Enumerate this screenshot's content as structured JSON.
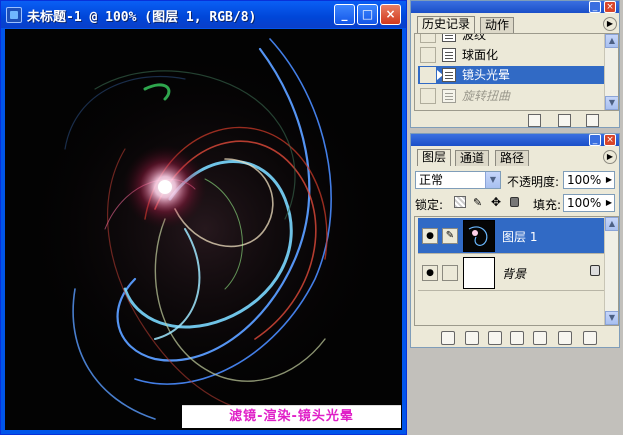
{
  "document": {
    "title": "未标题-1 @ 100% (图层 1, RGB/8)",
    "caption": "滤镜-渲染-镜头光晕",
    "controls": {
      "minimize": "_",
      "maximize": "□",
      "close": "×"
    }
  },
  "history_panel": {
    "tabs": [
      {
        "label": "历史记录",
        "active": true
      },
      {
        "label": "动作",
        "active": false
      }
    ],
    "menu_arrow": "▶",
    "items": [
      {
        "label": "波纹",
        "state": "normal"
      },
      {
        "label": "球面化",
        "state": "normal"
      },
      {
        "label": "镜头光晕",
        "state": "selected"
      },
      {
        "label": "旋转扭曲",
        "state": "faded"
      }
    ]
  },
  "layers_panel": {
    "tabs": [
      {
        "label": "图层",
        "active": true
      },
      {
        "label": "通道",
        "active": false
      },
      {
        "label": "路径",
        "active": false
      }
    ],
    "menu_arrow": "▶",
    "blend_mode": "正常",
    "opacity_label": "不透明度:",
    "opacity_value": "100%",
    "lock_label": "锁定:",
    "fill_label": "填充:",
    "fill_value": "100%",
    "layers": [
      {
        "name": "图层 1",
        "selected": true,
        "visible": true,
        "locked": false
      },
      {
        "name": "背景",
        "selected": false,
        "visible": true,
        "locked": true
      }
    ]
  },
  "colors": {
    "title_bar": "#0055ea",
    "selection": "#316ac5",
    "panel_bg": "#ece9d8",
    "caption_text": "#e020c8",
    "desktop": "#c2c0bb"
  }
}
